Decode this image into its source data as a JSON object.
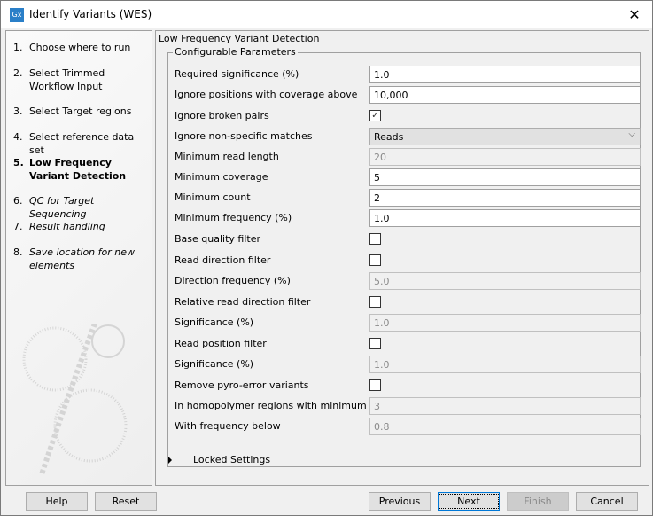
{
  "window": {
    "title": "Identify Variants (WES)",
    "app_icon": "Gx",
    "close_glyph": "✕"
  },
  "sidebar": {
    "steps": [
      {
        "num": "1.",
        "label": "Choose where to run",
        "style": "normal"
      },
      {
        "num": "2.",
        "label": "Select Trimmed Workflow Input",
        "style": "normal"
      },
      {
        "num": "3.",
        "label": "Select Target regions",
        "style": "normal"
      },
      {
        "num": "4.",
        "label": "Select reference data set",
        "style": "normal"
      },
      {
        "num": "5.",
        "label": "Low Frequency Variant Detection",
        "style": "bold"
      },
      {
        "num": "6.",
        "label": "QC for Target Sequencing",
        "style": "italic"
      },
      {
        "num": "7.",
        "label": "Result handling",
        "style": "italic"
      },
      {
        "num": "8.",
        "label": "Save location for new elements",
        "style": "italic"
      }
    ]
  },
  "main": {
    "panel_title": "Low Frequency Variant Detection",
    "group_title": "Configurable Parameters",
    "params": [
      {
        "label": "Required significance (%)",
        "type": "text",
        "value": "1.0",
        "enabled": true
      },
      {
        "label": "Ignore positions with coverage above",
        "type": "text",
        "value": "10,000",
        "enabled": true
      },
      {
        "label": "Ignore broken pairs",
        "type": "checkbox",
        "checked": true
      },
      {
        "label": "Ignore non-specific matches",
        "type": "select",
        "value": "Reads"
      },
      {
        "label": "Minimum read length",
        "type": "text",
        "value": "20",
        "enabled": false
      },
      {
        "label": "Minimum coverage",
        "type": "text",
        "value": "5",
        "enabled": true
      },
      {
        "label": "Minimum count",
        "type": "text",
        "value": "2",
        "enabled": true
      },
      {
        "label": "Minimum frequency (%)",
        "type": "text",
        "value": "1.0",
        "enabled": true
      },
      {
        "label": "Base quality filter",
        "type": "checkbox",
        "checked": false
      },
      {
        "label": "Read direction filter",
        "type": "checkbox",
        "checked": false
      },
      {
        "label": "Direction frequency (%)",
        "type": "text",
        "value": "5.0",
        "enabled": false
      },
      {
        "label": "Relative read direction filter",
        "type": "checkbox",
        "checked": false
      },
      {
        "label": "Significance (%)",
        "type": "text",
        "value": "1.0",
        "enabled": false
      },
      {
        "label": "Read position filter",
        "type": "checkbox",
        "checked": false
      },
      {
        "label": "Significance (%)",
        "type": "text",
        "value": "1.0",
        "enabled": false
      },
      {
        "label": "Remove pyro-error variants",
        "type": "checkbox",
        "checked": false
      },
      {
        "label": "In homopolymer regions with minimum length",
        "type": "text",
        "value": "3",
        "enabled": false
      },
      {
        "label": "With frequency below",
        "type": "text",
        "value": "0.8",
        "enabled": false
      }
    ],
    "locked_settings": "Locked Settings"
  },
  "footer": {
    "help": "Help",
    "reset": "Reset",
    "previous": "Previous",
    "next": "Next",
    "finish": "Finish",
    "cancel": "Cancel"
  }
}
